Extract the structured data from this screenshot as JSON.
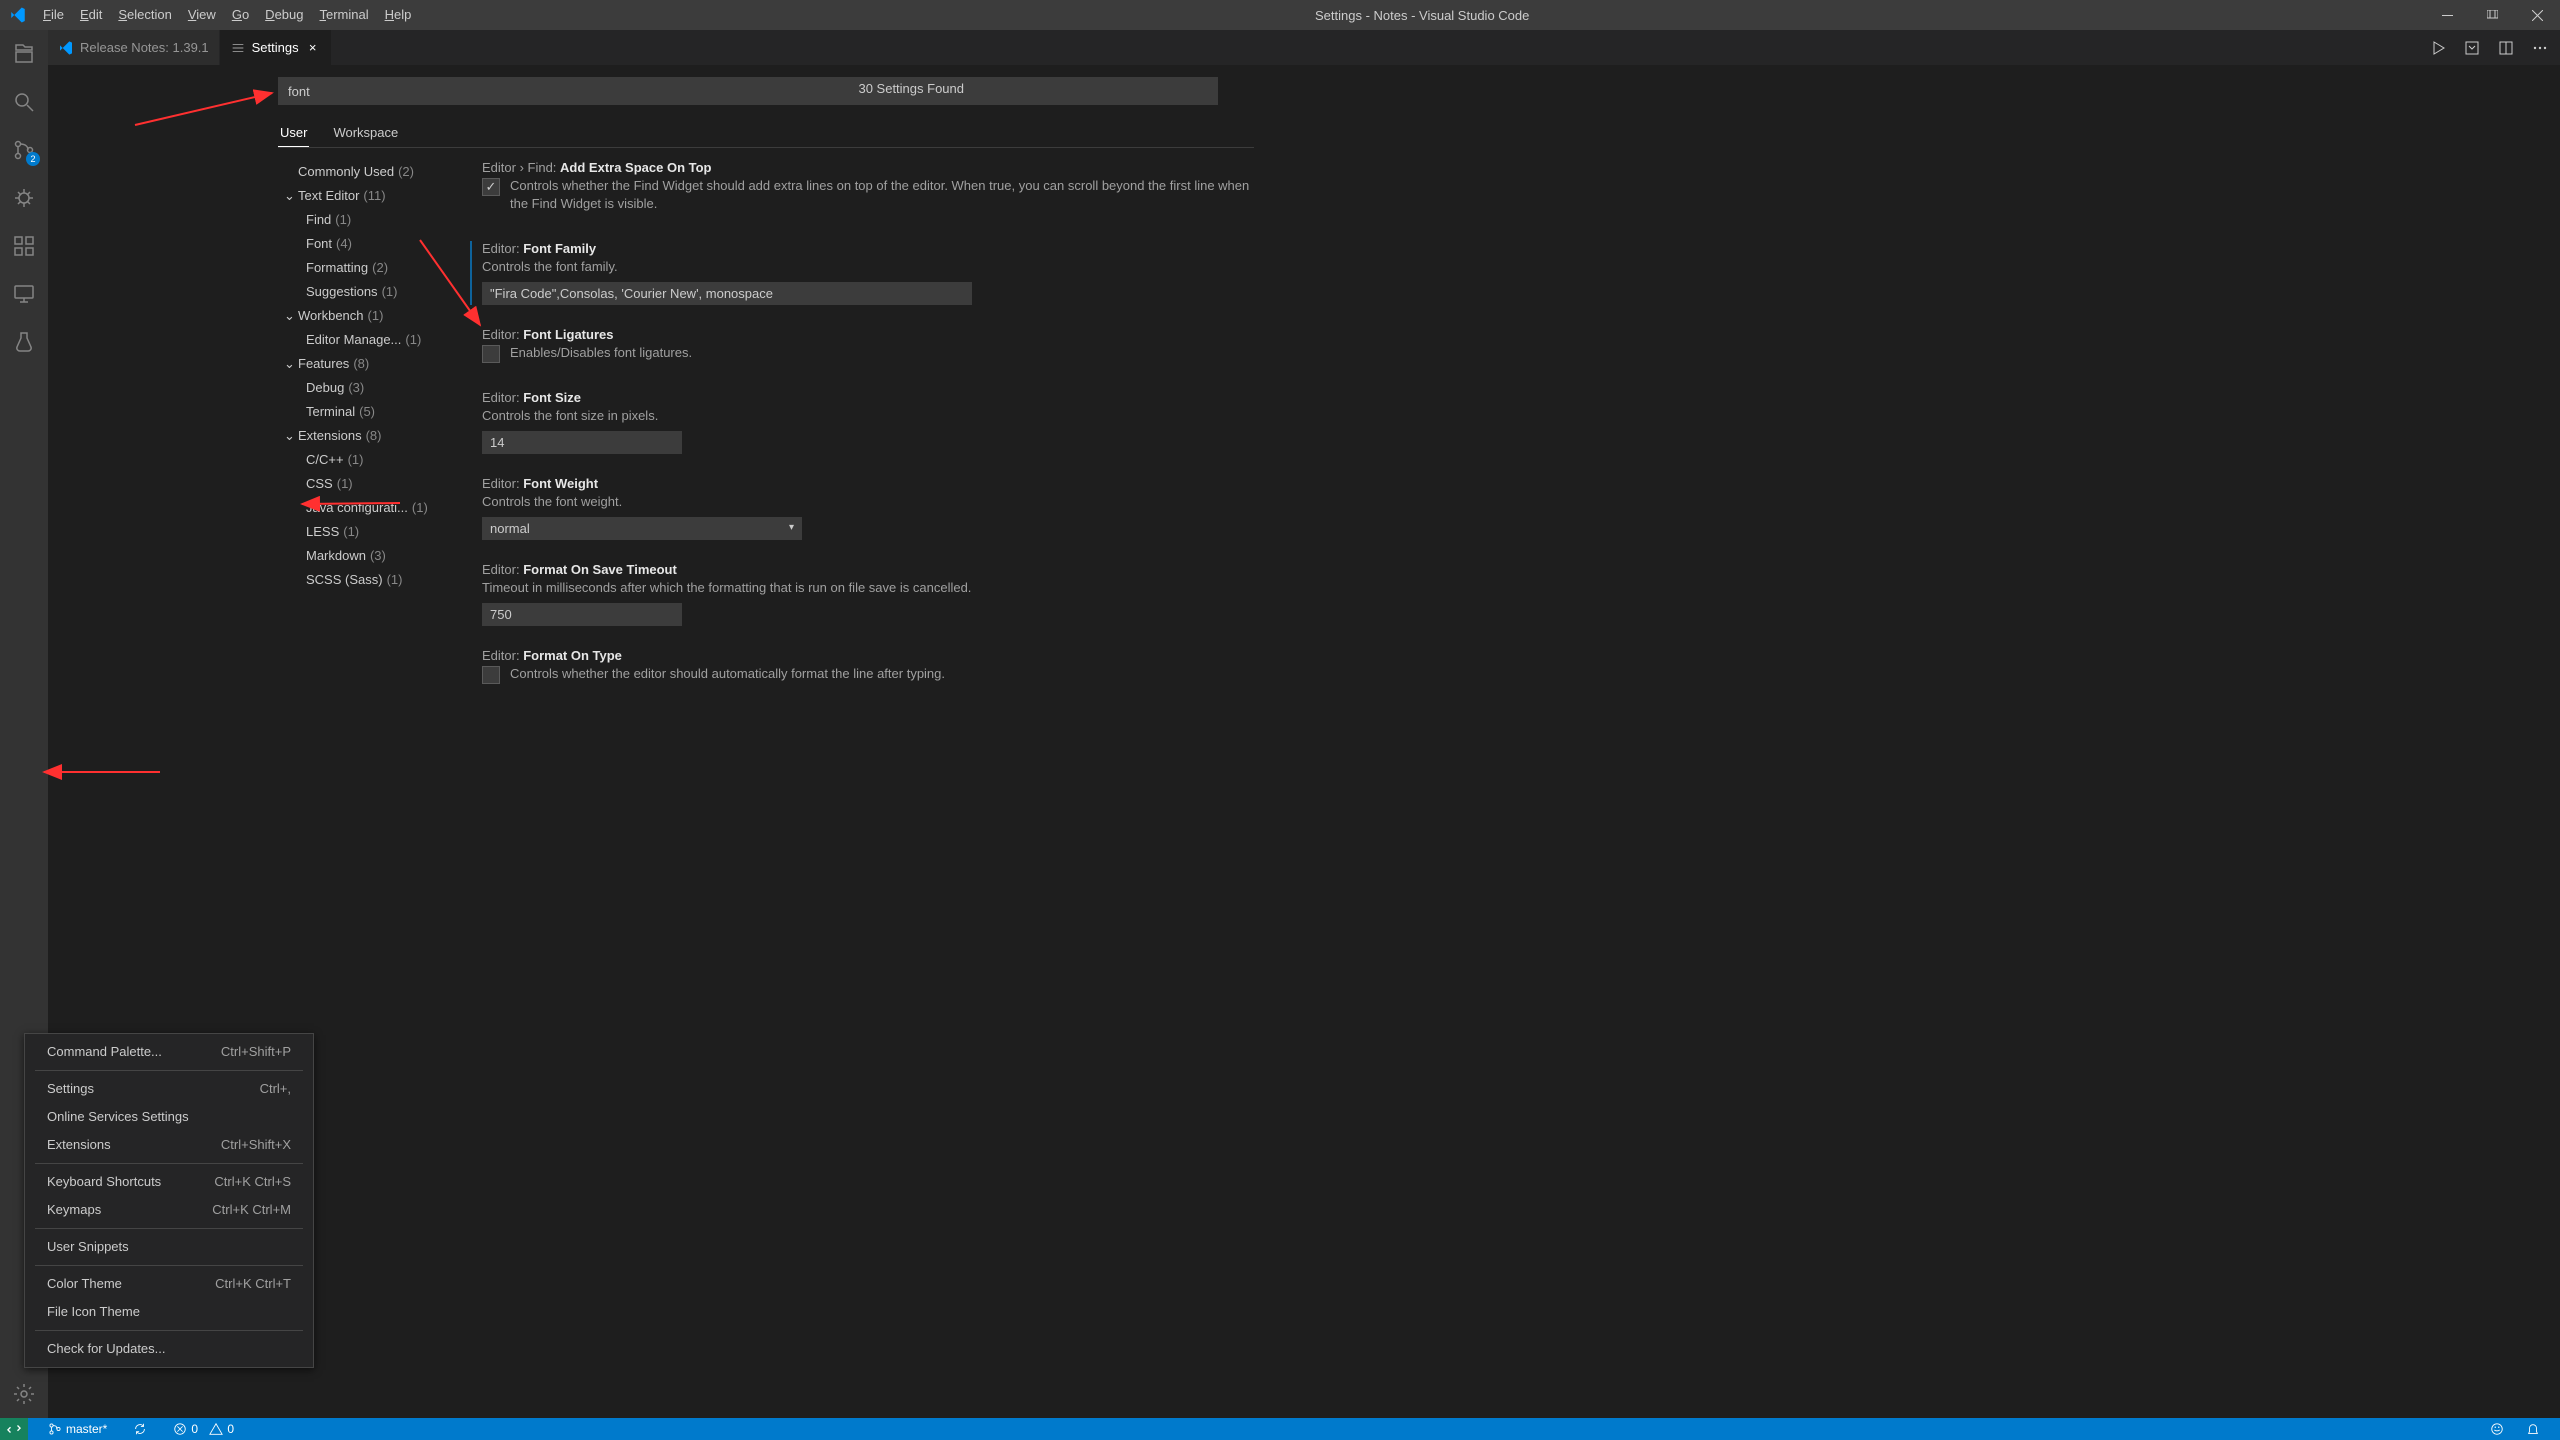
{
  "title": "Settings - Notes - Visual Studio Code",
  "menu": [
    "File",
    "Edit",
    "Selection",
    "View",
    "Go",
    "Debug",
    "Terminal",
    "Help"
  ],
  "tabs": [
    {
      "label": "Release Notes: 1.39.1",
      "active": false,
      "icon": "vscode"
    },
    {
      "label": "Settings",
      "active": true,
      "icon": "settings"
    }
  ],
  "search": {
    "value": "font",
    "results": "30 Settings Found"
  },
  "scopes": [
    "User",
    "Workspace"
  ],
  "tree": [
    {
      "label": "Commonly Used",
      "count": "(2)",
      "level": 0
    },
    {
      "label": "Text Editor",
      "count": "(11)",
      "level": 0,
      "expanded": true
    },
    {
      "label": "Find",
      "count": "(1)",
      "level": 1
    },
    {
      "label": "Font",
      "count": "(4)",
      "level": 1
    },
    {
      "label": "Formatting",
      "count": "(2)",
      "level": 1
    },
    {
      "label": "Suggestions",
      "count": "(1)",
      "level": 1
    },
    {
      "label": "Workbench",
      "count": "(1)",
      "level": 0,
      "expanded": true
    },
    {
      "label": "Editor Manage...",
      "count": "(1)",
      "level": 1
    },
    {
      "label": "Features",
      "count": "(8)",
      "level": 0,
      "expanded": true
    },
    {
      "label": "Debug",
      "count": "(3)",
      "level": 1
    },
    {
      "label": "Terminal",
      "count": "(5)",
      "level": 1
    },
    {
      "label": "Extensions",
      "count": "(8)",
      "level": 0,
      "expanded": true
    },
    {
      "label": "C/C++",
      "count": "(1)",
      "level": 1
    },
    {
      "label": "CSS",
      "count": "(1)",
      "level": 1
    },
    {
      "label": "Java configurati...",
      "count": "(1)",
      "level": 1
    },
    {
      "label": "LESS",
      "count": "(1)",
      "level": 1
    },
    {
      "label": "Markdown",
      "count": "(3)",
      "level": 1
    },
    {
      "label": "SCSS (Sass)",
      "count": "(1)",
      "level": 1
    }
  ],
  "settings": [
    {
      "prefix": "Editor › Find:",
      "name": "Add Extra Space On Top",
      "type": "checkbox",
      "checked": true,
      "desc": "Controls whether the Find Widget should add extra lines on top of the editor. When true, you can scroll beyond the first line when the Find Widget is visible."
    },
    {
      "prefix": "Editor:",
      "name": "Font Family",
      "type": "text",
      "value": "\"Fira Code\",Consolas, 'Courier New', monospace",
      "desc": "Controls the font family.",
      "modified": true
    },
    {
      "prefix": "Editor:",
      "name": "Font Ligatures",
      "type": "checkbox",
      "checked": false,
      "desc": "Enables/Disables font ligatures."
    },
    {
      "prefix": "Editor:",
      "name": "Font Size",
      "type": "number",
      "value": "14",
      "desc": "Controls the font size in pixels."
    },
    {
      "prefix": "Editor:",
      "name": "Font Weight",
      "type": "select",
      "value": "normal",
      "desc": "Controls the font weight."
    },
    {
      "prefix": "Editor:",
      "name": "Format On Save Timeout",
      "type": "number",
      "value": "750",
      "desc": "Timeout in milliseconds after which the formatting that is run on file save is cancelled."
    },
    {
      "prefix": "Editor:",
      "name": "Format On Type",
      "type": "checkbox",
      "checked": false,
      "desc": "Controls whether the editor should automatically format the line after typing."
    }
  ],
  "context_menu": [
    {
      "label": "Command Palette...",
      "shortcut": "Ctrl+Shift+P"
    },
    {
      "sep": true
    },
    {
      "label": "Settings",
      "shortcut": "Ctrl+,"
    },
    {
      "label": "Online Services Settings",
      "shortcut": ""
    },
    {
      "label": "Extensions",
      "shortcut": "Ctrl+Shift+X"
    },
    {
      "sep": true
    },
    {
      "label": "Keyboard Shortcuts",
      "shortcut": "Ctrl+K Ctrl+S"
    },
    {
      "label": "Keymaps",
      "shortcut": "Ctrl+K Ctrl+M"
    },
    {
      "sep": true
    },
    {
      "label": "User Snippets",
      "shortcut": ""
    },
    {
      "sep": true
    },
    {
      "label": "Color Theme",
      "shortcut": "Ctrl+K Ctrl+T"
    },
    {
      "label": "File Icon Theme",
      "shortcut": ""
    },
    {
      "sep": true
    },
    {
      "label": "Check for Updates...",
      "shortcut": ""
    }
  ],
  "status": {
    "branch": "master*",
    "errors": "0",
    "warnings": "0",
    "scm_badge": "2"
  }
}
